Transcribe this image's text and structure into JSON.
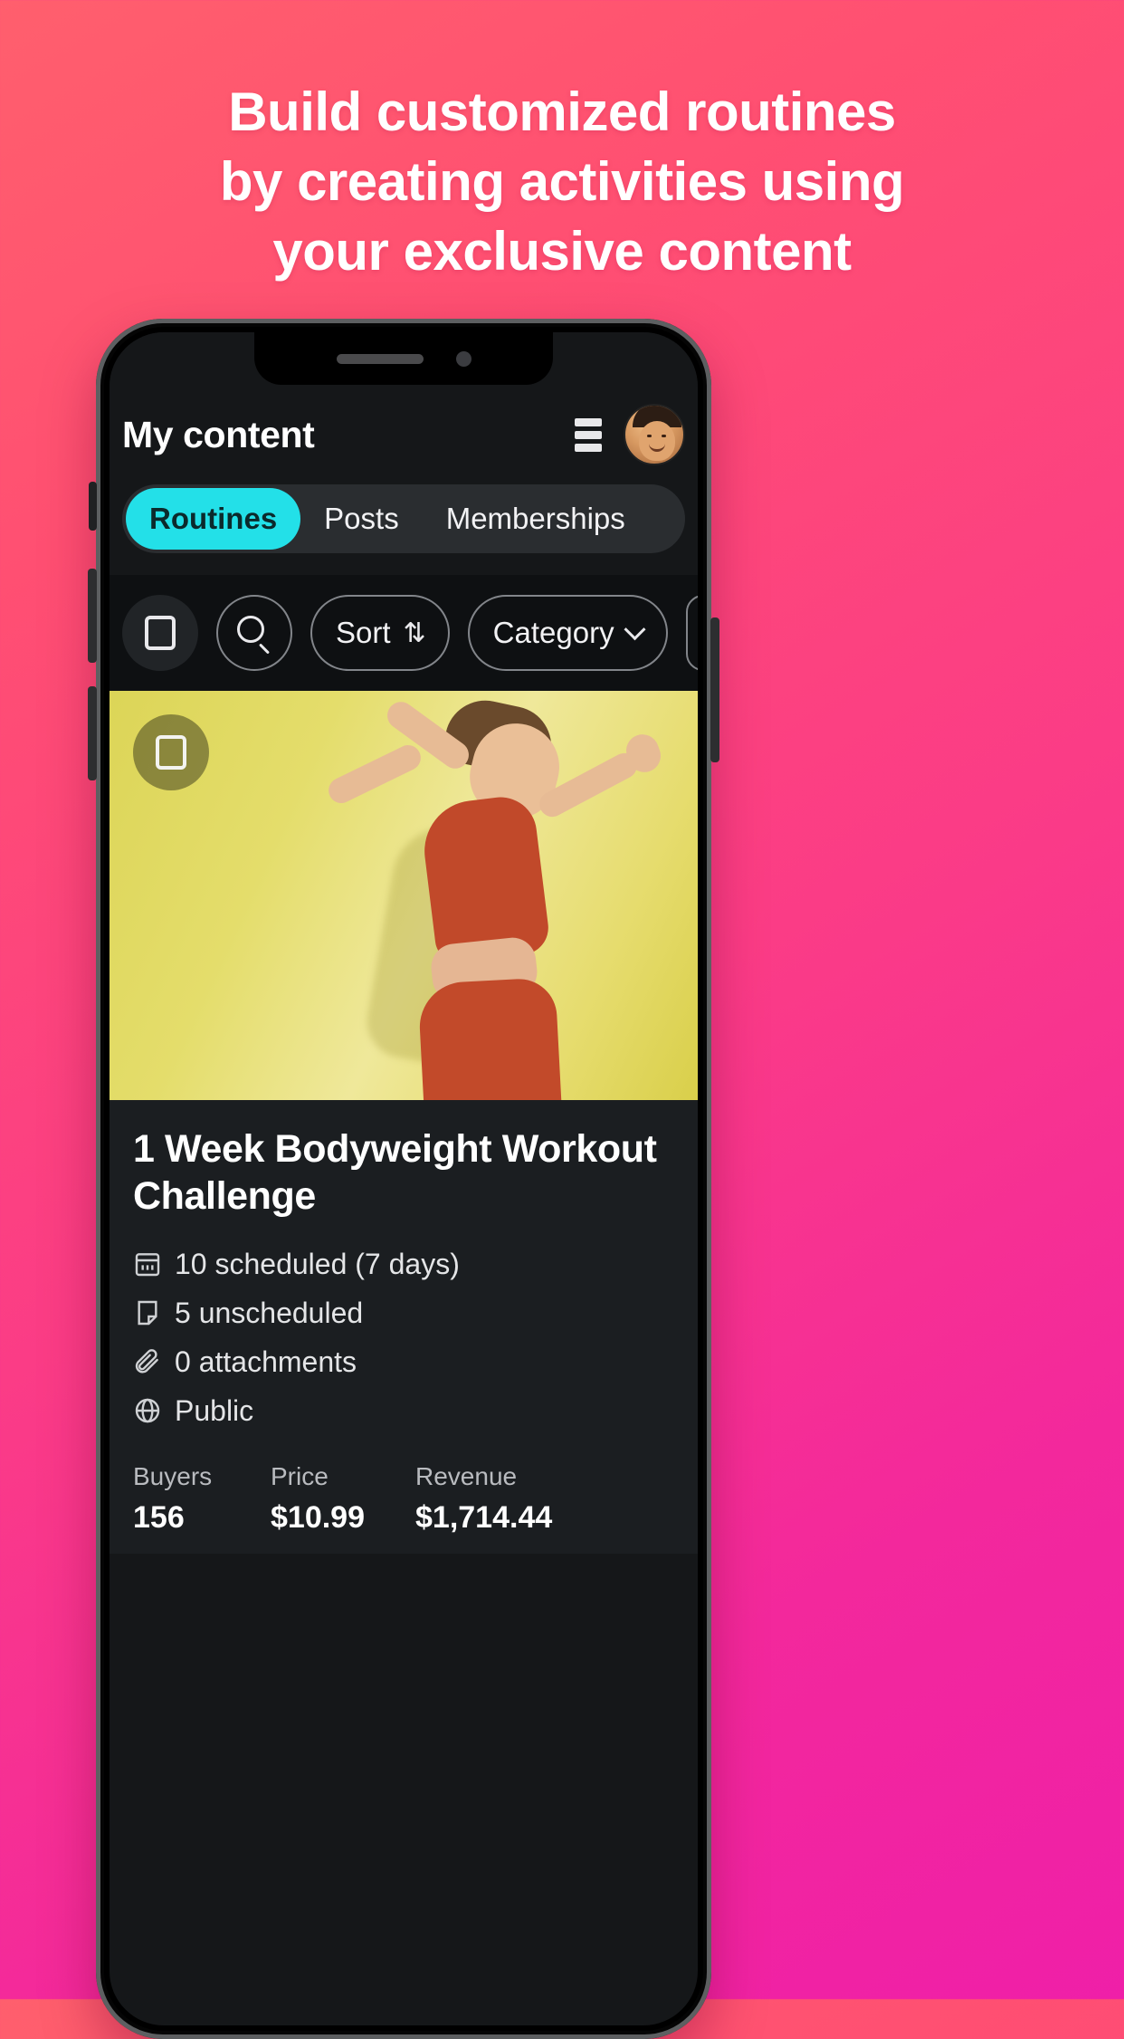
{
  "headline": {
    "line1": "Build customized routines",
    "line2": "by creating activities using",
    "line3": "your exclusive content",
    "color": "#ffffff"
  },
  "background": {
    "gradient_from": "#ff5f6d",
    "gradient_to": "#ef1fa8"
  },
  "app": {
    "header": {
      "title": "My content",
      "menu_icon": "list-view-icon",
      "avatar": "user-avatar"
    },
    "tabs": [
      {
        "label": "Routines",
        "active": true
      },
      {
        "label": "Posts",
        "active": false
      },
      {
        "label": "Memberships",
        "active": false
      }
    ],
    "accent_color": "#23e0e8",
    "filters": [
      {
        "name": "select-all",
        "type": "icon",
        "icon": "checkbox-square-icon",
        "label": ""
      },
      {
        "name": "search",
        "type": "icon",
        "icon": "search-icon",
        "label": ""
      },
      {
        "name": "sort",
        "type": "pill",
        "icon": "sort-arrows-icon",
        "label": "Sort"
      },
      {
        "name": "category",
        "type": "pill",
        "icon": "chevron-down-icon",
        "label": "Category"
      }
    ],
    "card": {
      "checkbox_icon": "checkbox-square-icon",
      "title": "1 Week Bodyweight Workout Challenge",
      "meta": [
        {
          "icon": "calendar-icon",
          "text": "10 scheduled (7 days)"
        },
        {
          "icon": "note-icon",
          "text": "5 unscheduled"
        },
        {
          "icon": "paperclip-icon",
          "text": "0 attachments"
        },
        {
          "icon": "globe-icon",
          "text": "Public"
        }
      ],
      "stats": [
        {
          "label": "Buyers",
          "value": "156"
        },
        {
          "label": "Price",
          "value": "$10.99"
        },
        {
          "label": "Revenue",
          "value": "$1,714.44"
        }
      ]
    }
  }
}
